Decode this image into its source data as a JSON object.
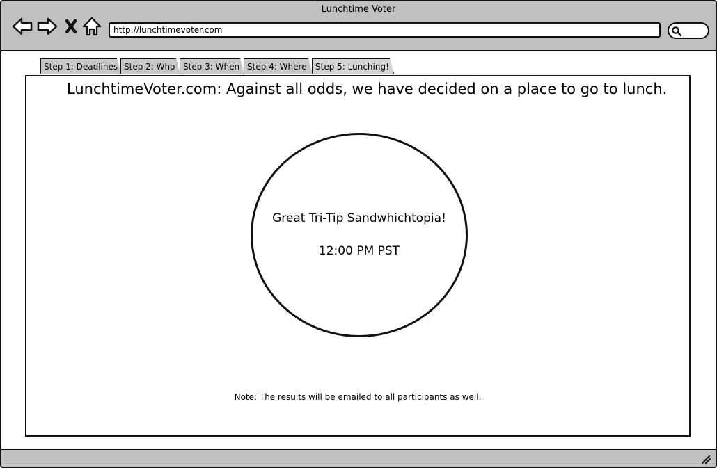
{
  "window": {
    "title": "Lunchtime Voter",
    "url": "http://lunchtimevoter.com"
  },
  "toolbar": {
    "back_icon": "arrow-left-icon",
    "forward_icon": "arrow-right-icon",
    "stop_icon": "close-icon",
    "home_icon": "home-icon",
    "search_icon": "search-icon"
  },
  "tabs": [
    {
      "label": "Step 1: Deadlines"
    },
    {
      "label": "Step 2: Who"
    },
    {
      "label": "Step 3: When"
    },
    {
      "label": "Step 4: Where"
    },
    {
      "label": "Step 5: Lunching!"
    }
  ],
  "main": {
    "headline": "LunchtimeVoter.com:  Against all odds, we have decided on a place to go to lunch.",
    "result": {
      "place": "Great Tri-Tip Sandwhichtopia!",
      "time": "12:00 PM PST"
    },
    "note": "Note: The results will be emailed to all participants as well."
  }
}
